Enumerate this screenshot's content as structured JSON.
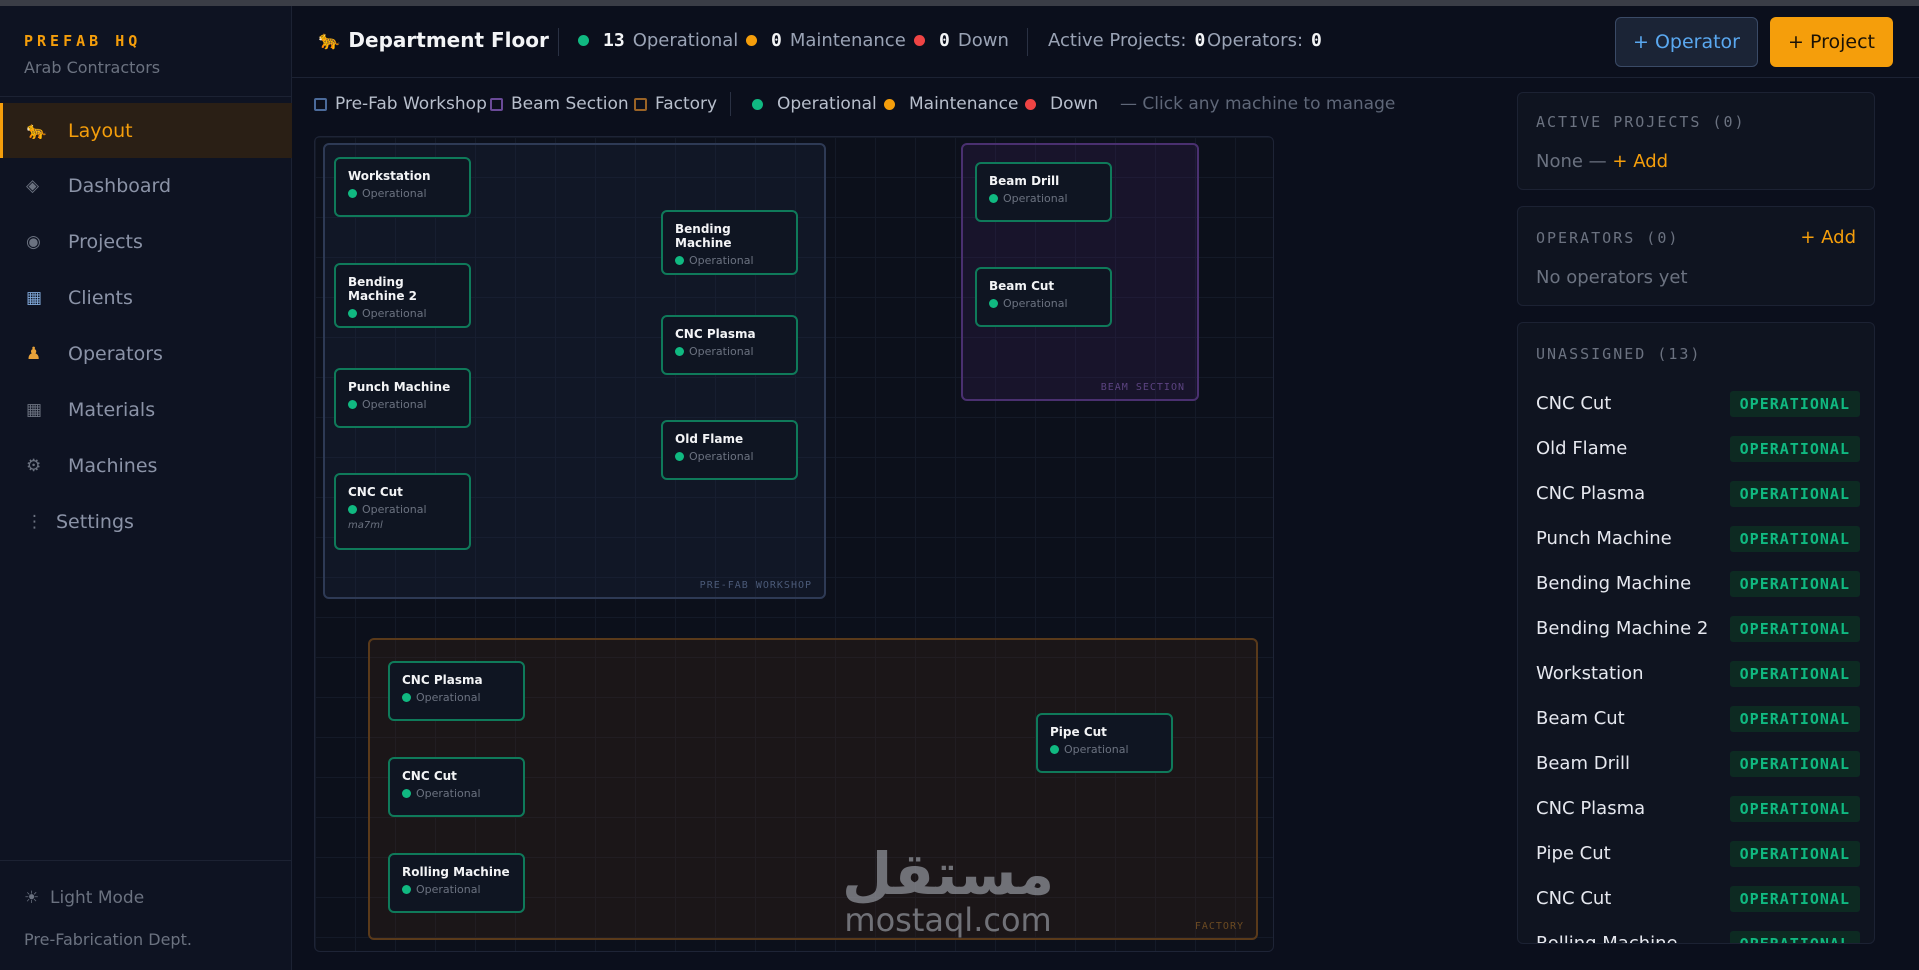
{
  "sidebar": {
    "brand_title": "PREFAB HQ",
    "brand_subtitle": "Arab Contractors",
    "items": [
      {
        "label": "Layout",
        "icon": "layout-icon"
      },
      {
        "label": "Dashboard",
        "icon": "dashboard-icon"
      },
      {
        "label": "Projects",
        "icon": "projects-icon"
      },
      {
        "label": "Clients",
        "icon": "clients-icon"
      },
      {
        "label": "Operators",
        "icon": "operators-icon"
      },
      {
        "label": "Materials",
        "icon": "materials-icon"
      },
      {
        "label": "Machines",
        "icon": "machines-icon"
      },
      {
        "label": "Settings",
        "icon": "settings-icon"
      }
    ],
    "light_mode_label": "Light Mode",
    "department": "Pre-Fabrication Dept."
  },
  "header": {
    "title": "Department Floor",
    "operational_count": "13",
    "operational_label": "Operational",
    "maintenance_count": "0",
    "maintenance_label": "Maintenance",
    "down_count": "0",
    "down_label": "Down",
    "active_projects_label": "Active Projects:",
    "active_projects_value": "0",
    "operators_label": "Operators:",
    "operators_value": "0",
    "add_operator_label": "+ Operator",
    "add_project_label": "+ Project"
  },
  "legend": {
    "prefab": "Pre-Fab Workshop",
    "beam": "Beam Section",
    "factory": "Factory",
    "operational": "Operational",
    "maintenance": "Maintenance",
    "down": "Down",
    "hint": "— Click any machine to manage"
  },
  "colors": {
    "accent": "#f59e0b",
    "operational": "#10b981",
    "maintenance": "#f59e0b",
    "down": "#ef4444",
    "prefab_zone": "#2e3a55",
    "beam_zone": "#4a3070",
    "factory_zone": "#5a3a1a"
  },
  "zones": {
    "prefab_label": "PRE-FAB WORKSHOP",
    "beam_label": "BEAM SECTION",
    "factory_label": "FACTORY"
  },
  "machines": {
    "workstation": {
      "name": "Workstation",
      "status": "Operational"
    },
    "bending2": {
      "name": "Bending Machine 2",
      "status": "Operational"
    },
    "punch": {
      "name": "Punch Machine",
      "status": "Operational"
    },
    "cnccut1": {
      "name": "CNC Cut",
      "status": "Operational",
      "note": "ma7ml"
    },
    "bending": {
      "name": "Bending Machine",
      "status": "Operational"
    },
    "cncplasma1": {
      "name": "CNC Plasma",
      "status": "Operational"
    },
    "oldflame": {
      "name": "Old Flame",
      "status": "Operational"
    },
    "beamdrill": {
      "name": "Beam Drill",
      "status": "Operational"
    },
    "beamcut": {
      "name": "Beam Cut",
      "status": "Operational"
    },
    "cncplasma2": {
      "name": "CNC Plasma",
      "status": "Operational"
    },
    "cnccut2": {
      "name": "CNC Cut",
      "status": "Operational"
    },
    "rolling": {
      "name": "Rolling Machine",
      "status": "Operational"
    },
    "pipecut": {
      "name": "Pipe Cut",
      "status": "Operational"
    }
  },
  "panel": {
    "active_projects_title": "ACTIVE PROJECTS (0)",
    "active_projects_none": "None —",
    "active_projects_add": "+ Add",
    "operators_title": "OPERATORS (0)",
    "operators_add": "+ Add",
    "operators_empty": "No operators yet",
    "unassigned_title": "UNASSIGNED (13)",
    "unassigned": [
      {
        "name": "CNC Cut",
        "status": "OPERATIONAL"
      },
      {
        "name": "Old Flame",
        "status": "OPERATIONAL"
      },
      {
        "name": "CNC Plasma",
        "status": "OPERATIONAL"
      },
      {
        "name": "Punch Machine",
        "status": "OPERATIONAL"
      },
      {
        "name": "Bending Machine",
        "status": "OPERATIONAL"
      },
      {
        "name": "Bending Machine 2",
        "status": "OPERATIONAL"
      },
      {
        "name": "Workstation",
        "status": "OPERATIONAL"
      },
      {
        "name": "Beam Cut",
        "status": "OPERATIONAL"
      },
      {
        "name": "Beam Drill",
        "status": "OPERATIONAL"
      },
      {
        "name": "CNC Plasma",
        "status": "OPERATIONAL"
      },
      {
        "name": "Pipe Cut",
        "status": "OPERATIONAL"
      },
      {
        "name": "CNC Cut",
        "status": "OPERATIONAL"
      },
      {
        "name": "Rolling Machine",
        "status": "OPERATIONAL"
      }
    ]
  },
  "watermark": {
    "arabic": "مستقل",
    "latin": "mostaql.com"
  }
}
